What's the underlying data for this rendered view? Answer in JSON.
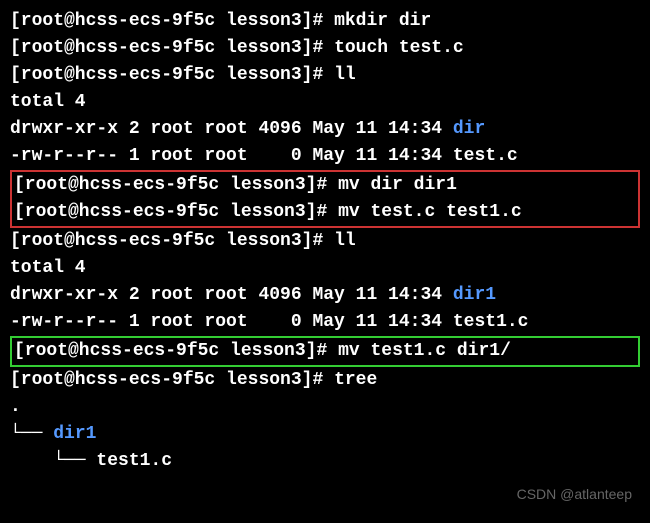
{
  "prompt": "[root@hcss-ecs-9f5c lesson3]# ",
  "commands": {
    "mkdir": "mkdir dir",
    "touch": "touch test.c",
    "ll1": "ll",
    "mv1": "mv dir dir1",
    "mv2": "mv test.c test1.c",
    "ll2": "ll",
    "mv3": "mv test1.c dir1/",
    "tree": "tree"
  },
  "output": {
    "total": "total 4",
    "ls1_dir_perm": "drwxr-xr-x 2 root root 4096 May 11 14:34 ",
    "ls1_dir_name": "dir",
    "ls1_file": "-rw-r--r-- 1 root root    0 May 11 14:34 test.c",
    "ls2_dir_perm": "drwxr-xr-x 2 root root 4096 May 11 14:34 ",
    "ls2_dir_name": "dir1",
    "ls2_file": "-rw-r--r-- 1 root root    0 May 11 14:34 test1.c",
    "tree_dot": ".",
    "tree_dir_pre": "└── ",
    "tree_dir": "dir1",
    "tree_file_pre": "    └── ",
    "tree_file": "test1.c"
  },
  "watermark": "CSDN @atlanteep"
}
